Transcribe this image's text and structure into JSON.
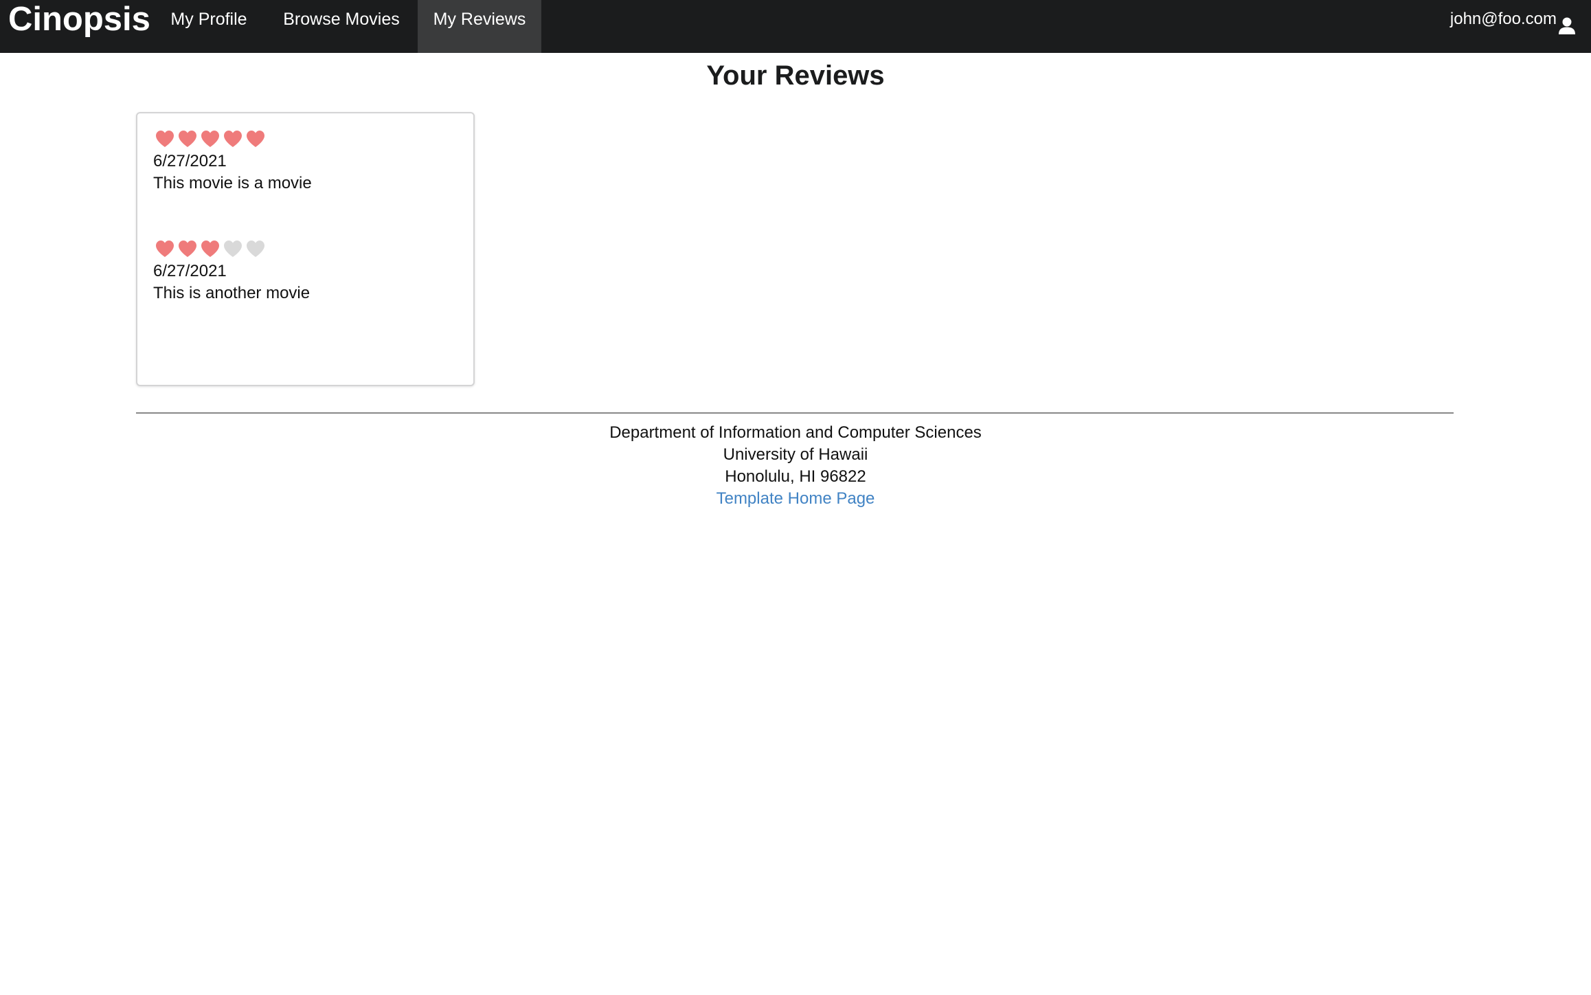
{
  "nav": {
    "brand": "Cinopsis",
    "items": [
      {
        "label": "My Profile",
        "active": false
      },
      {
        "label": "Browse Movies",
        "active": false
      },
      {
        "label": "My Reviews",
        "active": true
      }
    ],
    "user": "john@foo.com",
    "user_icon": "user-icon",
    "background": "#1b1c1d",
    "active_background": "#3a3b3c"
  },
  "page": {
    "title": "Your Reviews"
  },
  "reviews": [
    {
      "rating": 5,
      "max_rating": 5,
      "date": "6/27/2021",
      "text": "This movie is a movie"
    },
    {
      "rating": 3,
      "max_rating": 5,
      "date": "6/27/2021",
      "text": "This is another movie"
    }
  ],
  "rating_colors": {
    "filled": "#ef7b7b",
    "empty": "#d9d9d9"
  },
  "footer": {
    "line1": "Department of Information and Computer Sciences",
    "line2": "University of Hawaii",
    "line3": "Honolulu, HI 96822",
    "link": "Template Home Page",
    "link_color": "#4183c4"
  }
}
